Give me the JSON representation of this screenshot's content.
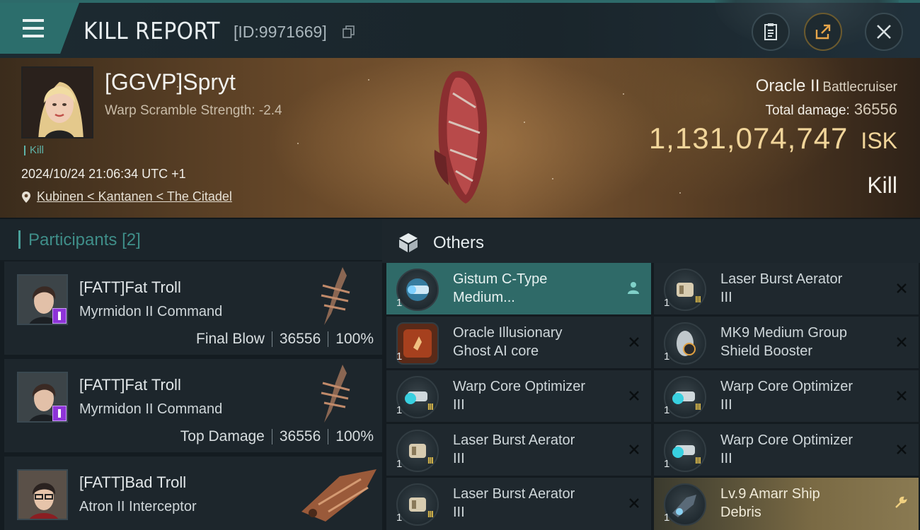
{
  "header": {
    "title": "KILL REPORT",
    "report_id": "[ID:9971669]",
    "buttons": [
      "clipboard-icon",
      "share-icon",
      "close-icon"
    ]
  },
  "victim": {
    "pilot_name": "[GGVP]Spryt",
    "warp_scramble": "Warp Scramble Strength: -2.4",
    "tag": "Kill",
    "timestamp": "2024/10/24 21:06:34 UTC +1",
    "location": "Kubinen < Kantanen < The Citadel",
    "ship_name": "Oracle II",
    "ship_class": "Battlecruiser",
    "total_damage_label": "Total damage:",
    "total_damage": "36556",
    "isk_value": "1,131,074,747",
    "isk_unit": "ISK",
    "result": "Kill"
  },
  "participants": {
    "title": "Participants",
    "count": "[2]",
    "items": [
      {
        "name": "[FATT]Fat Troll",
        "ship": "Myrmidon II Command",
        "role": "Final Blow",
        "damage": "36556",
        "percent": "100%"
      },
      {
        "name": "[FATT]Fat Troll",
        "ship": "Myrmidon II Command",
        "role": "Top Damage",
        "damage": "36556",
        "percent": "100%"
      },
      {
        "name": "[FATT]Bad Troll",
        "ship": "Atron II Interceptor"
      }
    ]
  },
  "others": {
    "title": "Others",
    "items": [
      {
        "line1": "Gistum C-Type",
        "line2": "Medium...",
        "qty": "1",
        "state": "selected",
        "tier": ""
      },
      {
        "line1": "Laser Burst Aerator",
        "line2": "III",
        "qty": "1",
        "state": "normal",
        "tier": "III"
      },
      {
        "line1": "Oracle Illusionary",
        "line2": "Ghost AI core",
        "qty": "1",
        "state": "normal",
        "tier": ""
      },
      {
        "line1": "MK9 Medium Group",
        "line2": "Shield Booster",
        "qty": "1",
        "state": "normal",
        "tier": ""
      },
      {
        "line1": "Warp Core Optimizer",
        "line2": "III",
        "qty": "1",
        "state": "normal",
        "tier": "III"
      },
      {
        "line1": "Warp Core Optimizer",
        "line2": "III",
        "qty": "1",
        "state": "normal",
        "tier": "III"
      },
      {
        "line1": "Laser Burst Aerator",
        "line2": "III",
        "qty": "1",
        "state": "normal",
        "tier": "III"
      },
      {
        "line1": "Warp Core Optimizer",
        "line2": "III",
        "qty": "1",
        "state": "normal",
        "tier": "III"
      },
      {
        "line1": "Laser Burst Aerator",
        "line2": "III",
        "qty": "1",
        "state": "normal",
        "tier": "III"
      },
      {
        "line1": "Lv.9 Amarr Ship",
        "line2": "Debris",
        "qty": "1",
        "state": "gold",
        "tier": ""
      }
    ]
  },
  "colors": {
    "accent_teal": "#2c6e6c",
    "isk_gold": "#f1d59a",
    "selected_item": "#2f6a68"
  }
}
